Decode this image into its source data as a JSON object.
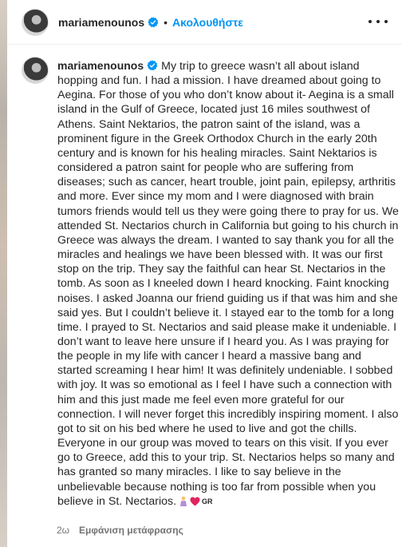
{
  "header": {
    "username": "mariamenounos",
    "separator": "•",
    "follow_label": "Ακολουθήστε",
    "icons": {
      "avatar": "profile-avatar",
      "verified": "verified-badge-icon",
      "more": "more-options-icon"
    },
    "colors": {
      "follow": "#0095f6",
      "verified": "#0095f6"
    }
  },
  "post": {
    "username": "mariamenounos",
    "caption": "My trip to greece wasn’t all about island hopping and fun. I had a mission. I have dreamed about going to Aegina. For those of you who don’t know about it- Aegina is a small island in the Gulf of Greece, located just 16 miles southwest of Athens. Saint Nektarios, the patron saint of the island, was a prominent figure in the Greek Orthodox Church in the early 20th century and is known for his healing miracles. Saint Nektarios is considered a patron saint for people who are suffering from diseases; such as cancer, heart trouble, joint pain, epilepsy, arthritis and more. Ever since my mom and I were diagnosed with brain tumors friends would tell us they were going there to pray for us. We attended St. Nectarios church in California but going to his church in Greece was always the dream. I wanted to say thank you for all the miracles and healings we have been blessed with. It was our first stop on the trip. They say the faithful can hear St. Nectarios in the tomb. As soon as I kneeled down I heard knocking. Faint knocking noises. I asked Joanna our friend guiding us if that was him and she said yes. But I couldn’t believe it. I stayed ear to the tomb for a long time. I prayed to St. Nectarios and said please make it undeniable. I don’t want to leave here unsure if I heard you. As I was praying for the people in my life with cancer I heard a massive bang and started screaming I hear him! It was definitely undeniable. I sobbed with joy. It was so emotional as I feel I have such a connection with him and this just made me feel even more grateful for our connection. I will never forget this incredibly inspiring moment. I also got to sit on his bed where he used to live and got the chills. Everyone in our group was moved to tears on this visit. If you ever go to Greece, add this to your trip. St. Nectarios helps so many and has granted so many miracles. I like to say believe in the unbelievable because nothing is too far from possible when you believe in St. Nectarios.",
    "emojis": [
      "praying-person-emoji",
      "red-heart-emoji"
    ],
    "flag_text": "GR",
    "heart_color": "#e0245e",
    "time_ago": "2ω",
    "translate_label": "Εμφάνιση μετάφρασης"
  }
}
